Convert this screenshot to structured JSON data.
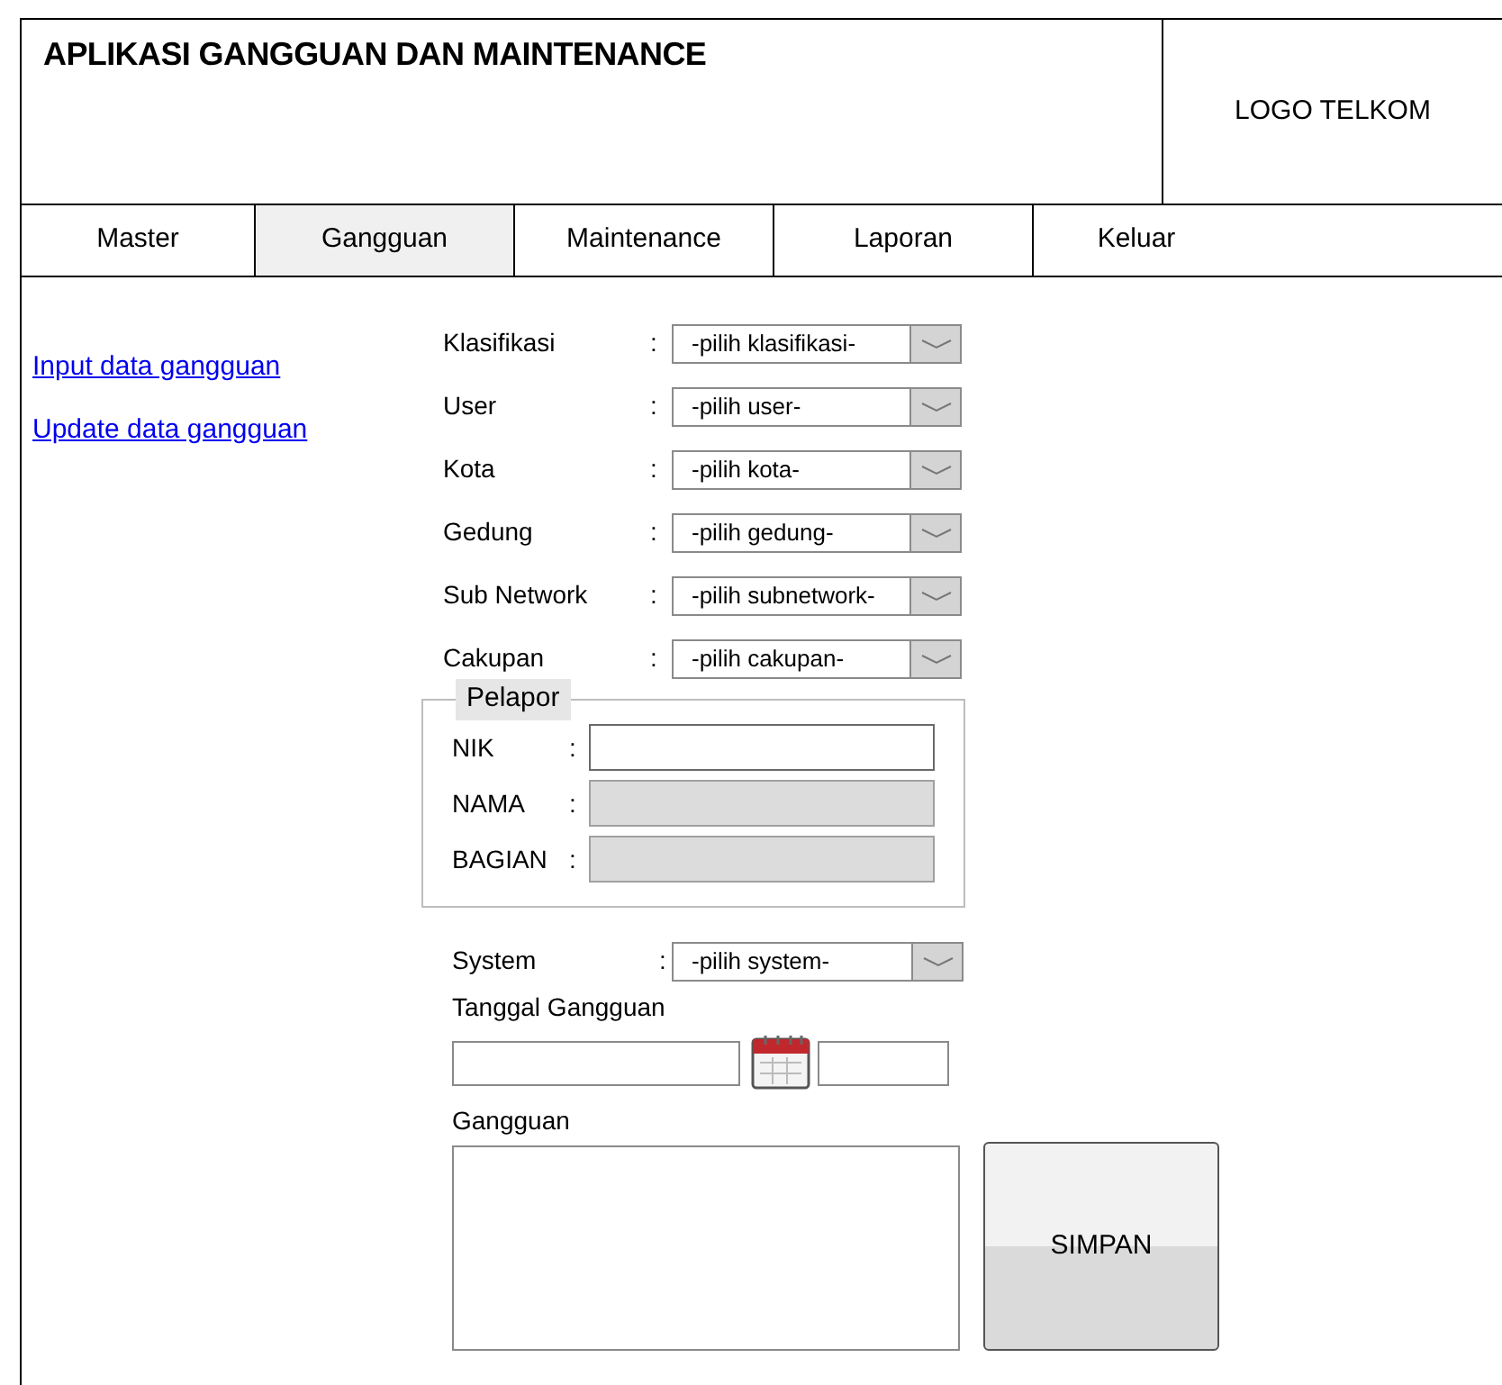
{
  "header": {
    "title": "APLIKASI GANGGUAN DAN MAINTENANCE",
    "logo": "LOGO TELKOM"
  },
  "tabs": [
    {
      "label": "Master",
      "selected": false
    },
    {
      "label": "Gangguan",
      "selected": true
    },
    {
      "label": "Maintenance",
      "selected": false
    },
    {
      "label": "Laporan",
      "selected": false
    },
    {
      "label": "Keluar",
      "selected": false
    }
  ],
  "sidebar": {
    "links": [
      "Input data gangguan",
      "Update data gangguan"
    ]
  },
  "form": {
    "separator": ":",
    "selects": [
      {
        "label": "Klasifikasi",
        "value": "-pilih klasifikasi-"
      },
      {
        "label": "User",
        "value": "-pilih user-"
      },
      {
        "label": "Kota",
        "value": "-pilih kota-"
      },
      {
        "label": "Gedung",
        "value": "-pilih gedung-"
      },
      {
        "label": "Sub Network",
        "value": "-pilih subnetwork-"
      },
      {
        "label": "Cakupan",
        "value": "-pilih cakupan-"
      }
    ],
    "pelapor": {
      "title": "Pelapor",
      "fields": [
        {
          "label": "NIK",
          "disabled": false
        },
        {
          "label": "NAMA",
          "disabled": true
        },
        {
          "label": "BAGIAN",
          "disabled": true
        }
      ]
    },
    "system": {
      "label": "System",
      "value": "-pilih system-"
    },
    "date_label": "Tanggal Gangguan",
    "gangguan_label": "Gangguan",
    "save_button": "SIMPAN"
  }
}
